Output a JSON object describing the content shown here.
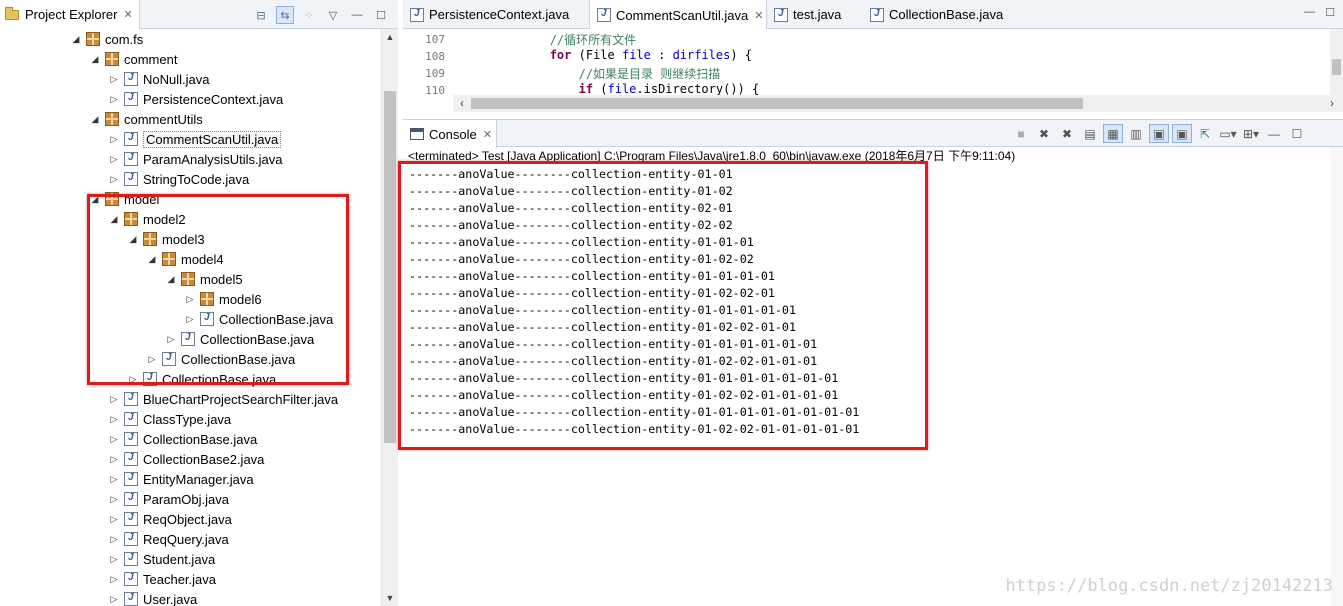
{
  "project_explorer": {
    "tab_label": "Project Explorer",
    "close_glyph": "✕",
    "tree": [
      {
        "label": "com.fs",
        "kind": "package",
        "depth": 0,
        "expanded": true
      },
      {
        "label": "comment",
        "kind": "package",
        "depth": 1,
        "expanded": true
      },
      {
        "label": "NoNull.java",
        "kind": "java",
        "depth": 2,
        "expanded": false
      },
      {
        "label": "PersistenceContext.java",
        "kind": "java",
        "depth": 2,
        "expanded": false
      },
      {
        "label": "commentUtils",
        "kind": "package",
        "depth": 1,
        "expanded": true
      },
      {
        "label": "CommentScanUtil.java",
        "kind": "java",
        "depth": 2,
        "expanded": false,
        "selected": true
      },
      {
        "label": "ParamAnalysisUtils.java",
        "kind": "java",
        "depth": 2,
        "expanded": false
      },
      {
        "label": "StringToCode.java",
        "kind": "java",
        "depth": 2,
        "expanded": false
      },
      {
        "label": "model",
        "kind": "package",
        "depth": 1,
        "expanded": true
      },
      {
        "label": "model2",
        "kind": "package",
        "depth": 2,
        "expanded": true
      },
      {
        "label": "model3",
        "kind": "package",
        "depth": 3,
        "expanded": true
      },
      {
        "label": "model4",
        "kind": "package",
        "depth": 4,
        "expanded": true
      },
      {
        "label": "model5",
        "kind": "package",
        "depth": 5,
        "expanded": true
      },
      {
        "label": "model6",
        "kind": "package",
        "depth": 6,
        "expanded": false
      },
      {
        "label": "CollectionBase.java",
        "kind": "java",
        "depth": 6,
        "expanded": false
      },
      {
        "label": "CollectionBase.java",
        "kind": "java",
        "depth": 5,
        "expanded": false
      },
      {
        "label": "CollectionBase.java",
        "kind": "java",
        "depth": 4,
        "expanded": false
      },
      {
        "label": "CollectionBase.java",
        "kind": "java",
        "depth": 3,
        "expanded": false
      },
      {
        "label": "BlueChartProjectSearchFilter.java",
        "kind": "java",
        "depth": 2,
        "expanded": false
      },
      {
        "label": "ClassType.java",
        "kind": "java",
        "depth": 2,
        "expanded": false
      },
      {
        "label": "CollectionBase.java",
        "kind": "java",
        "depth": 2,
        "expanded": false
      },
      {
        "label": "CollectionBase2.java",
        "kind": "java",
        "depth": 2,
        "expanded": false
      },
      {
        "label": "EntityManager.java",
        "kind": "java",
        "depth": 2,
        "expanded": false
      },
      {
        "label": "ParamObj.java",
        "kind": "java",
        "depth": 2,
        "expanded": false
      },
      {
        "label": "ReqObject.java",
        "kind": "java",
        "depth": 2,
        "expanded": false
      },
      {
        "label": "ReqQuery.java",
        "kind": "java",
        "depth": 2,
        "expanded": false
      },
      {
        "label": "Student.java",
        "kind": "java",
        "depth": 2,
        "expanded": false
      },
      {
        "label": "Teacher.java",
        "kind": "java",
        "depth": 2,
        "expanded": false
      },
      {
        "label": "User.java",
        "kind": "java",
        "depth": 2,
        "expanded": false
      }
    ]
  },
  "editor": {
    "tabs": [
      {
        "label": "PersistenceContext.java",
        "active": false
      },
      {
        "label": "CommentScanUtil.java",
        "active": true
      },
      {
        "label": "test.java",
        "active": false
      },
      {
        "label": "CollectionBase.java",
        "active": false
      }
    ],
    "lines": [
      {
        "num": "107",
        "indent": "            ",
        "comment": "//循环所有文件"
      },
      {
        "num": "108",
        "indent": "            ",
        "kw": "for",
        "text1": " (File ",
        "var": "file",
        "text2": " : ",
        "var2": "dirfiles",
        "text3": ") {"
      },
      {
        "num": "109",
        "indent": "                ",
        "comment": "//如果是目录 则继续扫描"
      },
      {
        "num": "110",
        "indent": "                ",
        "kw": "if",
        "text1": " (",
        "var": "file",
        "text2": ".isDirectory()) {"
      }
    ]
  },
  "console": {
    "tab_label": "Console",
    "status": "<terminated> Test [Java Application] C:\\Program Files\\Java\\jre1.8.0_60\\bin\\javaw.exe (2018年6月7日 下午9:11:04)",
    "lines": [
      "-------anoValue--------collection-entity-01-01",
      "-------anoValue--------collection-entity-01-02",
      "-------anoValue--------collection-entity-02-01",
      "-------anoValue--------collection-entity-02-02",
      "-------anoValue--------collection-entity-01-01-01",
      "-------anoValue--------collection-entity-01-02-02",
      "-------anoValue--------collection-entity-01-01-01-01",
      "-------anoValue--------collection-entity-01-02-02-01",
      "-------anoValue--------collection-entity-01-01-01-01-01",
      "-------anoValue--------collection-entity-01-02-02-01-01",
      "-------anoValue--------collection-entity-01-01-01-01-01-01",
      "-------anoValue--------collection-entity-01-02-02-01-01-01",
      "-------anoValue--------collection-entity-01-01-01-01-01-01-01",
      "-------anoValue--------collection-entity-01-02-02-01-01-01-01",
      "-------anoValue--------collection-entity-01-01-01-01-01-01-01-01",
      "-------anoValue--------collection-entity-01-02-02-01-01-01-01-01"
    ]
  },
  "watermark": "https://blog.csdn.net/zj20142213",
  "colors": {
    "highlight": "#e0191d",
    "comment": "#3f7f5f",
    "keyword": "#7f0055",
    "variable": "#0000c0"
  }
}
